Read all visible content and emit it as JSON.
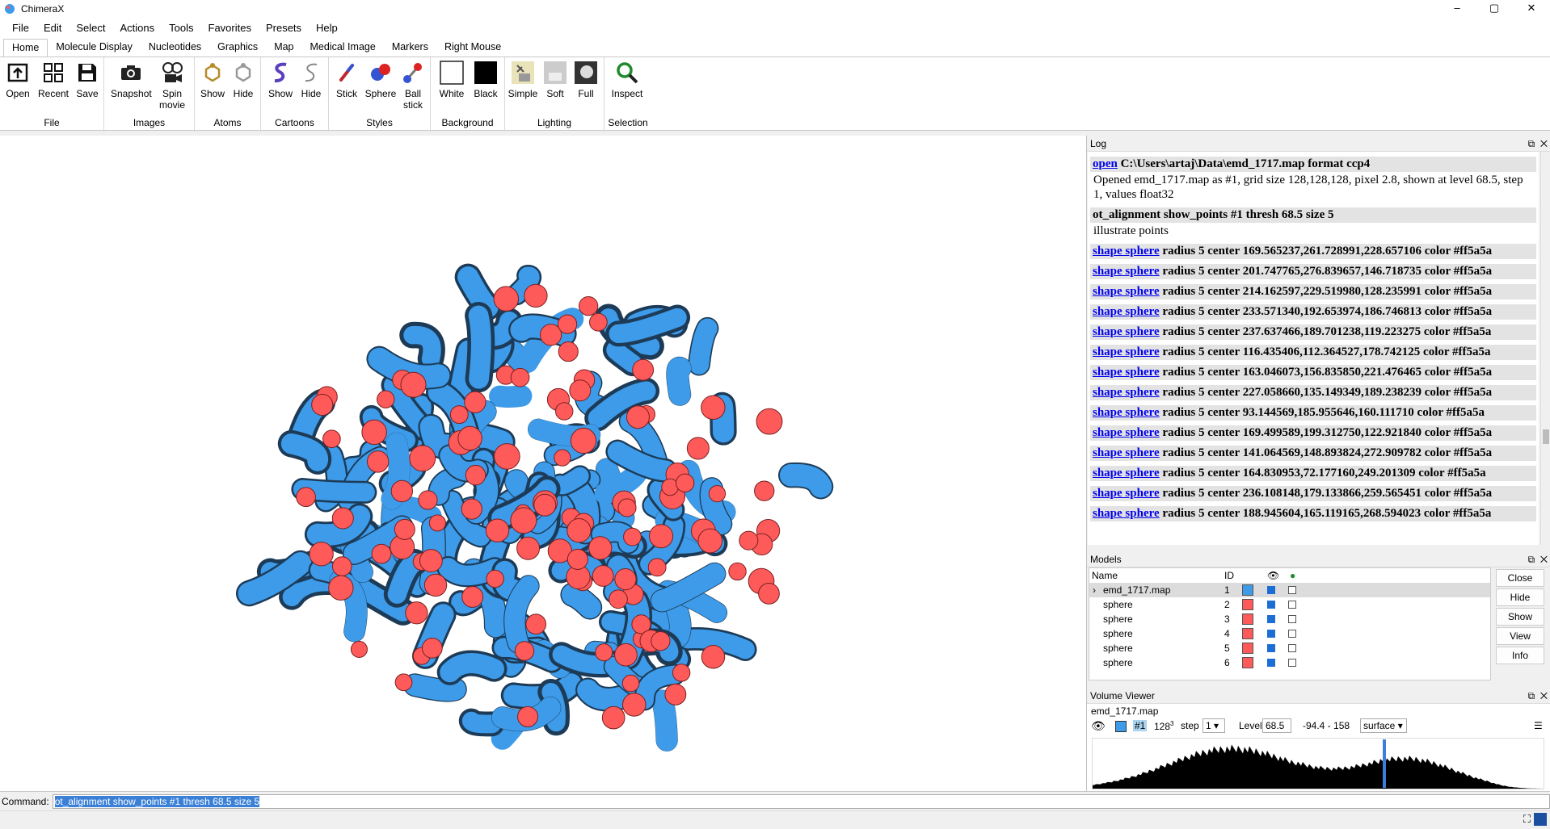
{
  "window": {
    "title": "ChimeraX",
    "minimize": "–",
    "maximize": "▢",
    "close": "✕"
  },
  "menu": [
    "File",
    "Edit",
    "Select",
    "Actions",
    "Tools",
    "Favorites",
    "Presets",
    "Help"
  ],
  "tabs": [
    "Home",
    "Molecule Display",
    "Nucleotides",
    "Graphics",
    "Map",
    "Medical Image",
    "Markers",
    "Right Mouse"
  ],
  "ribbon": {
    "groups": [
      {
        "label": "File",
        "buttons": [
          "Open",
          "Recent",
          "Save"
        ]
      },
      {
        "label": "Images",
        "buttons": [
          "Snapshot",
          "Spin movie"
        ]
      },
      {
        "label": "Atoms",
        "buttons": [
          "Show",
          "Hide"
        ]
      },
      {
        "label": "Cartoons",
        "buttons": [
          "Show",
          "Hide"
        ]
      },
      {
        "label": "Styles",
        "buttons": [
          "Stick",
          "Sphere",
          "Ball stick"
        ]
      },
      {
        "label": "Background",
        "buttons": [
          "White",
          "Black"
        ]
      },
      {
        "label": "Lighting",
        "buttons": [
          "Simple",
          "Soft",
          "Full"
        ]
      },
      {
        "label": "Selection",
        "buttons": [
          "Inspect"
        ]
      }
    ]
  },
  "log": {
    "title": "Log",
    "open_cmd_link": "open",
    "open_cmd_rest": "C:\\Users\\artaj\\Data\\emd_1717.map format ccp4",
    "open_result": "Opened emd_1717.map as #1, grid size 128,128,128, pixel 2.8, shown at level 68.5, step 1, values float32",
    "ot_cmd": "ot_alignment show_points #1 thresh 68.5 size 5",
    "ot_result": "illustrate points",
    "shape_link": "shape sphere",
    "shape_lines": [
      "radius 5 center 169.565237,261.728991,228.657106 color #ff5a5a",
      "radius 5 center 201.747765,276.839657,146.718735 color #ff5a5a",
      "radius 5 center 214.162597,229.519980,128.235991 color #ff5a5a",
      "radius 5 center 233.571340,192.653974,186.746813 color #ff5a5a",
      "radius 5 center 237.637466,189.701238,119.223275 color #ff5a5a",
      "radius 5 center 116.435406,112.364527,178.742125 color #ff5a5a",
      "radius 5 center 163.046073,156.835850,221.476465 color #ff5a5a",
      "radius 5 center 227.058660,135.149349,189.238239 color #ff5a5a",
      "radius 5 center 93.144569,185.955646,160.111710 color #ff5a5a",
      "radius 5 center 169.499589,199.312750,122.921840 color #ff5a5a",
      "radius 5 center 141.064569,148.893824,272.909782 color #ff5a5a",
      "radius 5 center 164.830953,72.177160,249.201309 color #ff5a5a",
      "radius 5 center 236.108148,179.133866,259.565451 color #ff5a5a",
      "radius 5 center 188.945604,165.119165,268.594023 color #ff5a5a"
    ]
  },
  "models": {
    "title": "Models",
    "headers": {
      "name": "Name",
      "id": "ID"
    },
    "rows": [
      {
        "name": "emd_1717.map",
        "id": "1",
        "color": "#3d9be9"
      },
      {
        "name": "sphere",
        "id": "2",
        "color": "#ff5a5a"
      },
      {
        "name": "sphere",
        "id": "3",
        "color": "#ff5a5a"
      },
      {
        "name": "sphere",
        "id": "4",
        "color": "#ff5a5a"
      },
      {
        "name": "sphere",
        "id": "5",
        "color": "#ff5a5a"
      },
      {
        "name": "sphere",
        "id": "6",
        "color": "#ff5a5a"
      }
    ],
    "buttons": [
      "Close",
      "Hide",
      "Show",
      "View",
      "Info"
    ]
  },
  "volume_viewer": {
    "title": "Volume Viewer",
    "map_name": "emd_1717.map",
    "model_id": "#1",
    "grid_size_base": "128",
    "grid_size_exp": "3",
    "step_label": "step",
    "step_value": "1",
    "level_label": "Level",
    "level_value": "68.5",
    "range": "-94.4 - 158",
    "style": "surface"
  },
  "command": {
    "label": "Command:",
    "value": "ot_alignment show_points #1 thresh 68.5 size 5"
  },
  "colors": {
    "map_blue": "#3d9be9",
    "sphere_red": "#ff5a5a",
    "link_blue": "#0000ee"
  }
}
